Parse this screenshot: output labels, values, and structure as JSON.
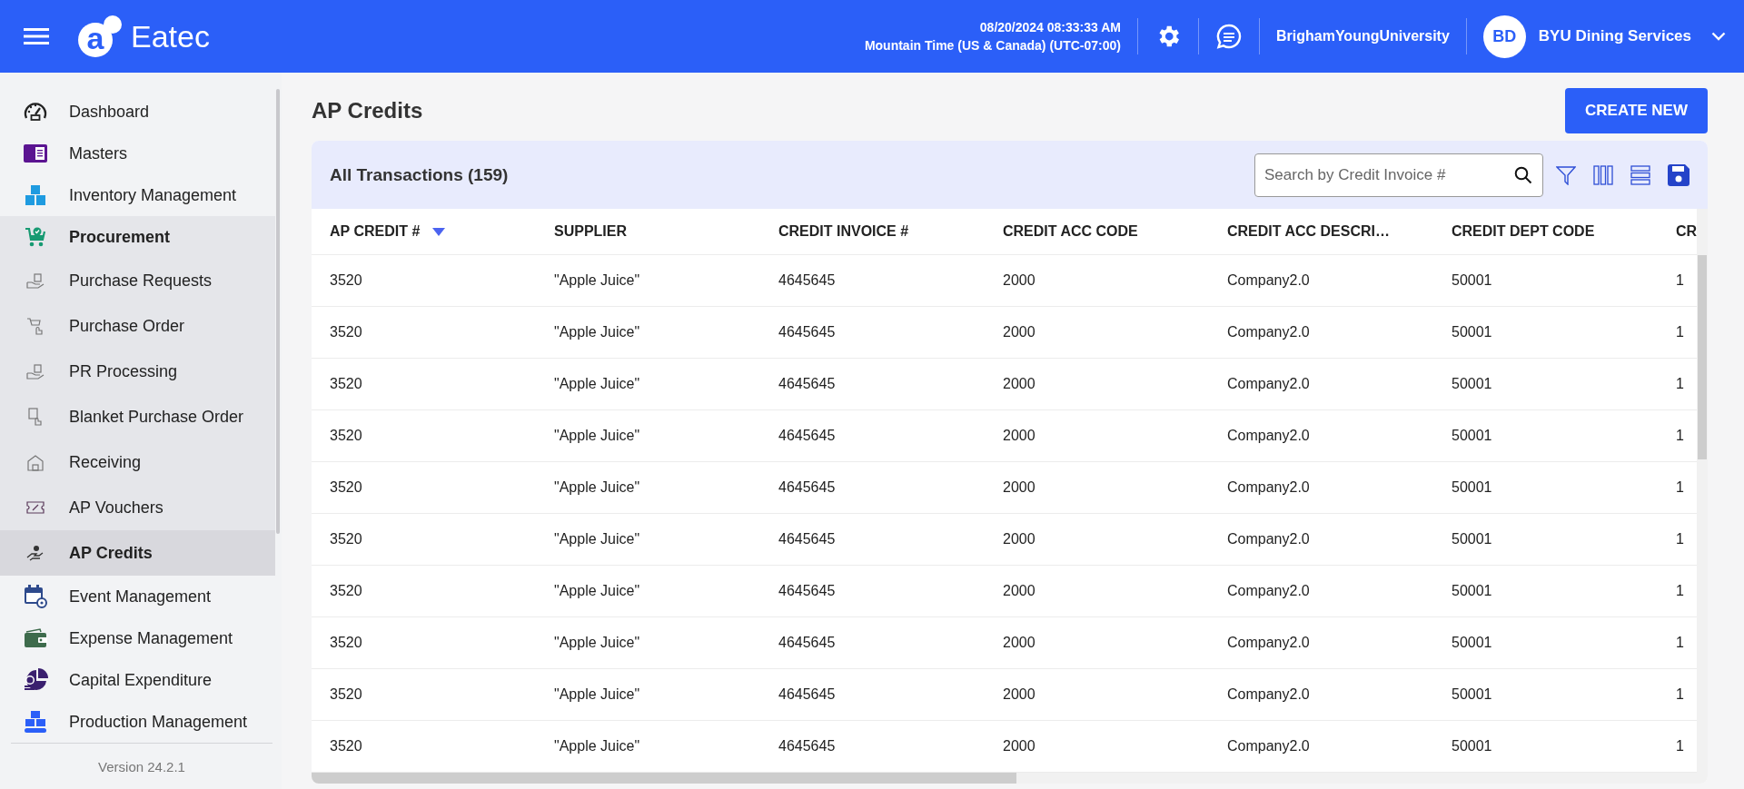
{
  "header": {
    "logo_mark": "a",
    "app_name": "Eatec",
    "datetime": "08/20/2024 08:33:33 AM",
    "timezone": "Mountain Time (US & Canada) (UTC-07:00)",
    "organization": "BrighamYoungUniversity",
    "user_initials": "BD",
    "user_name": "BYU Dining Services"
  },
  "sidebar": {
    "items": [
      {
        "label": "Dashboard",
        "selected": false
      },
      {
        "label": "Masters",
        "selected": false
      },
      {
        "label": "Inventory Management",
        "selected": false
      },
      {
        "label": "Procurement",
        "selected": false,
        "expanded": true,
        "children": [
          {
            "label": "Purchase Requests",
            "selected": false
          },
          {
            "label": "Purchase Order",
            "selected": false
          },
          {
            "label": "PR Processing",
            "selected": false
          },
          {
            "label": "Blanket Purchase Order",
            "selected": false
          },
          {
            "label": "Receiving",
            "selected": false
          },
          {
            "label": "AP Vouchers",
            "selected": false
          },
          {
            "label": "AP Credits",
            "selected": true
          }
        ]
      },
      {
        "label": "Event Management",
        "selected": false
      },
      {
        "label": "Expense Management",
        "selected": false
      },
      {
        "label": "Capital Expenditure",
        "selected": false
      },
      {
        "label": "Production Management",
        "selected": false
      }
    ],
    "version": "Version 24.2.1"
  },
  "page": {
    "title": "AP Credits",
    "create_button": "CREATE NEW"
  },
  "table": {
    "title": "All Transactions (159)",
    "search": {
      "placeholder": "Search by Credit Invoice #"
    },
    "columns": [
      {
        "label": "AP CREDIT #",
        "sorted": true
      },
      {
        "label": "SUPPLIER",
        "sorted": false
      },
      {
        "label": "CREDIT INVOICE #",
        "sorted": false
      },
      {
        "label": "CREDIT ACC CODE",
        "sorted": false
      },
      {
        "label": "CREDIT ACC DESCRI…",
        "sorted": false
      },
      {
        "label": "CREDIT DEPT CODE",
        "sorted": false
      },
      {
        "label": "CR",
        "sorted": false
      }
    ],
    "rows": [
      [
        "3520",
        "\"Apple Juice\"",
        "4645645",
        "2000",
        "Company2.0",
        "50001",
        "1"
      ],
      [
        "3520",
        "\"Apple Juice\"",
        "4645645",
        "2000",
        "Company2.0",
        "50001",
        "1"
      ],
      [
        "3520",
        "\"Apple Juice\"",
        "4645645",
        "2000",
        "Company2.0",
        "50001",
        "1"
      ],
      [
        "3520",
        "\"Apple Juice\"",
        "4645645",
        "2000",
        "Company2.0",
        "50001",
        "1"
      ],
      [
        "3520",
        "\"Apple Juice\"",
        "4645645",
        "2000",
        "Company2.0",
        "50001",
        "1"
      ],
      [
        "3520",
        "\"Apple Juice\"",
        "4645645",
        "2000",
        "Company2.0",
        "50001",
        "1"
      ],
      [
        "3520",
        "\"Apple Juice\"",
        "4645645",
        "2000",
        "Company2.0",
        "50001",
        "1"
      ],
      [
        "3520",
        "\"Apple Juice\"",
        "4645645",
        "2000",
        "Company2.0",
        "50001",
        "1"
      ],
      [
        "3520",
        "\"Apple Juice\"",
        "4645645",
        "2000",
        "Company2.0",
        "50001",
        "1"
      ],
      [
        "3520",
        "\"Apple Juice\"",
        "4645645",
        "2000",
        "Company2.0",
        "50001",
        "1"
      ]
    ]
  }
}
